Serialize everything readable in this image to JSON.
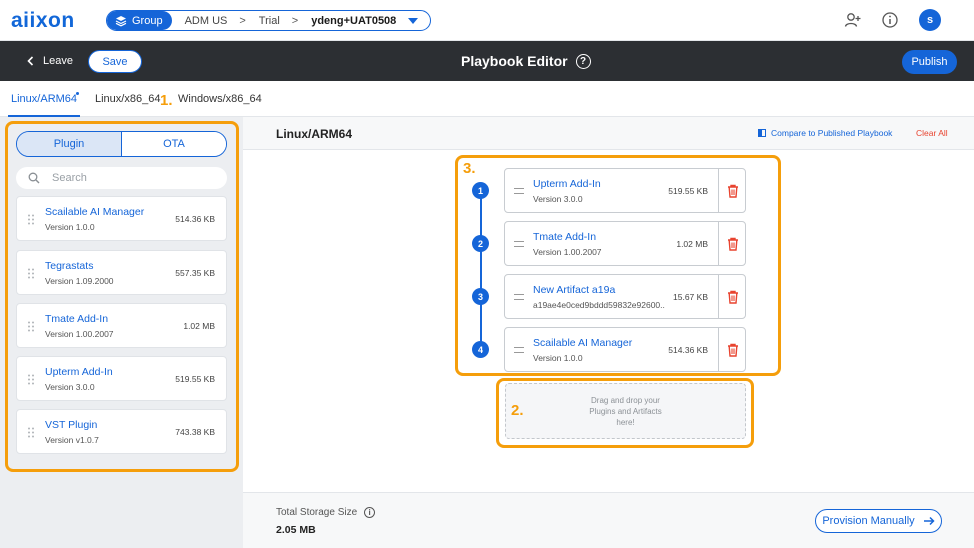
{
  "header": {
    "logo": "aiixon",
    "breadcrumb": {
      "group_label": "Group",
      "items": [
        "ADM US",
        "Trial",
        "ydeng+UAT0508"
      ],
      "separator": ">"
    },
    "avatar_initial": "s"
  },
  "editor_bar": {
    "leave_label": "Leave",
    "save_label": "Save",
    "title": "Playbook Editor",
    "help_glyph": "?",
    "publish_label": "Publish"
  },
  "arch_tabs": [
    {
      "label": "Linux/ARM64",
      "active": true
    },
    {
      "label": "Linux/x86_64",
      "active": false
    },
    {
      "label": "Windows/x86_64",
      "active": false
    }
  ],
  "left_panel": {
    "segments": [
      "Plugin",
      "OTA"
    ],
    "active_segment": "Plugin",
    "search_placeholder": "Search",
    "plugins": [
      {
        "name": "Scailable AI Manager",
        "version": "Version 1.0.0",
        "size": "514.36 KB"
      },
      {
        "name": "Tegrastats",
        "version": "Version 1.09.2000",
        "size": "557.35 KB"
      },
      {
        "name": "Tmate Add-In",
        "version": "Version 1.00.2007",
        "size": "1.02 MB"
      },
      {
        "name": "Upterm Add-In",
        "version": "Version 3.0.0",
        "size": "519.55 KB"
      },
      {
        "name": "VST Plugin",
        "version": "Version v1.0.7",
        "size": "743.38 KB"
      }
    ]
  },
  "main": {
    "title": "Linux/ARM64",
    "compare_label": "Compare to Published Playbook",
    "clear_label": "Clear All",
    "playbook": [
      {
        "step": "1",
        "name": "Upterm Add-In",
        "version": "Version 3.0.0",
        "size": "519.55 KB"
      },
      {
        "step": "2",
        "name": "Tmate Add-In",
        "version": "Version 1.00.2007",
        "size": "1.02 MB"
      },
      {
        "step": "3",
        "name": "New Artifact a19a",
        "version": "a19ae4e0ced9bddd59832e92600...",
        "size": "15.67 KB"
      },
      {
        "step": "4",
        "name": "Scailable AI Manager",
        "version": "Version 1.0.0",
        "size": "514.36 KB"
      }
    ],
    "dropzone": {
      "line1": "Drag and drop your",
      "line2": "Plugins and Artifacts",
      "line3": "here!"
    }
  },
  "annotations": {
    "n1": "1.",
    "n2": "2.",
    "n3": "3."
  },
  "footer": {
    "storage_label": "Total Storage Size",
    "storage_value": "2.05 MB",
    "provision_label": "Provision Manually"
  },
  "colors": {
    "brand": "#1565d8",
    "highlight": "#f59e0b",
    "danger": "#e8432f",
    "editor_bar": "#2c2f33"
  }
}
